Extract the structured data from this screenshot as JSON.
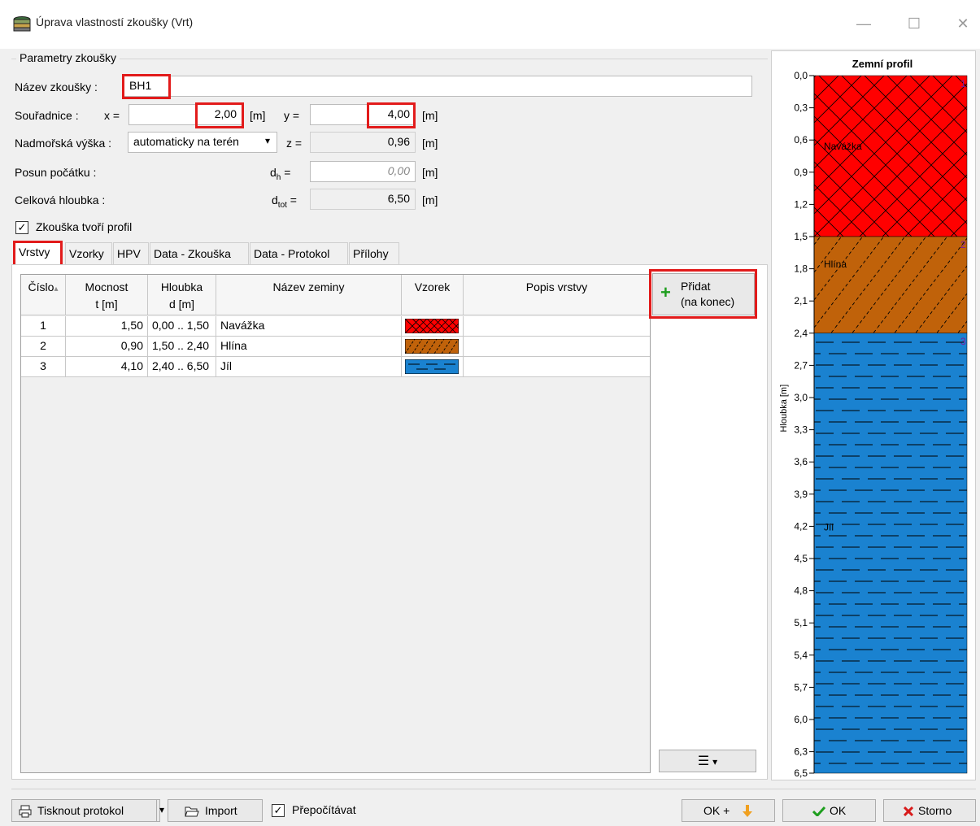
{
  "window": {
    "title": "Úprava vlastností zkoušky (Vrt)",
    "min": "—",
    "max": "☐",
    "close": "✕"
  },
  "params": {
    "group_title": "Parametry zkoušky",
    "name_label": "Název zkoušky :",
    "name_value": "BH1",
    "coords_label": "Souřadnice :",
    "x_label": "x =",
    "x_value": "2,00",
    "x_unit": "[m]",
    "y_label": "y =",
    "y_value": "4,00",
    "y_unit": "[m]",
    "elev_label": "Nadmořská výška :",
    "elev_option": "automaticky na terén",
    "z_label": "z =",
    "z_value": "0,96",
    "z_unit": "[m]",
    "shift_label": "Posun počátku :",
    "dh_label": "d",
    "dh_sub": "h",
    "dh_eq": " =",
    "dh_value": "0,00",
    "dh_unit": "[m]",
    "depth_label": "Celková hloubka :",
    "dtot_label": "d",
    "dtot_sub": "tot",
    "dtot_eq": " =",
    "dtot_value": "6,50",
    "dtot_unit": "[m]",
    "profile_check_label": "Zkouška tvoří profil",
    "profile_check": "✓"
  },
  "tabs": [
    "Vrstvy",
    "Vzorky",
    "HPV",
    "Data - Zkouška",
    "Data - Protokol",
    "Přílohy"
  ],
  "table": {
    "headers": [
      {
        "l1": "Číslo",
        "l2": ""
      },
      {
        "l1": "Mocnost",
        "l2": "t [m]"
      },
      {
        "l1": "Hloubka",
        "l2": "d [m]"
      },
      {
        "l1": "Název zeminy",
        "l2": ""
      },
      {
        "l1": "Vzorek",
        "l2": ""
      },
      {
        "l1": "Popis vrstvy",
        "l2": ""
      }
    ],
    "sort_icon": "▴",
    "rows": [
      {
        "num": "1",
        "thick": "1,50",
        "depth": "0,00 .. 1,50",
        "name": "Navážka",
        "desc": ""
      },
      {
        "num": "2",
        "thick": "0,90",
        "depth": "1,50 .. 2,40",
        "name": "Hlína",
        "desc": ""
      },
      {
        "num": "3",
        "thick": "4,10",
        "depth": "2,40 .. 6,50",
        "name": "Jíl",
        "desc": ""
      }
    ]
  },
  "add_button": {
    "line1": "Přidat",
    "line2": "(na konec)",
    "icon": "+"
  },
  "list_button": {
    "icon": "☰",
    "arrow": "▾"
  },
  "profile": {
    "title": "Zemní profil",
    "axis_label": "Hloubka [m]",
    "ticks": [
      "0,0",
      "0,3",
      "0,6",
      "0,9",
      "1,2",
      "1,5",
      "1,8",
      "2,1",
      "2,4",
      "2,7",
      "3,0",
      "3,3",
      "3,6",
      "3,9",
      "4,2",
      "4,5",
      "4,8",
      "5,1",
      "5,4",
      "5,7",
      "6,0",
      "6,3",
      "6,5"
    ],
    "max_depth": 6.5,
    "layers": [
      {
        "num": "1",
        "name": "Navážka",
        "from": 0.0,
        "to": 1.5,
        "color": "#ff0000",
        "pattern": "cross"
      },
      {
        "num": "2",
        "name": "Hlína",
        "from": 1.5,
        "to": 2.4,
        "color": "#c0620a",
        "pattern": "diag"
      },
      {
        "num": "3",
        "name": "Jíl",
        "from": 2.4,
        "to": 6.5,
        "color": "#1a82d0",
        "pattern": "dash"
      }
    ]
  },
  "footer": {
    "print_label": "Tisknout protokol",
    "import_label": "Import",
    "recalc_label": "Přepočítávat",
    "recalc_check": "✓",
    "okplus_label": "OK +",
    "ok_label": "OK",
    "cancel_label": "Storno",
    "dropdown_arrow": "▾"
  },
  "colors": {
    "highlight": "#e21b1b",
    "ok_green": "#1e9e1e",
    "cancel_red": "#d81b1b",
    "arrow_orange": "#f0a020"
  }
}
